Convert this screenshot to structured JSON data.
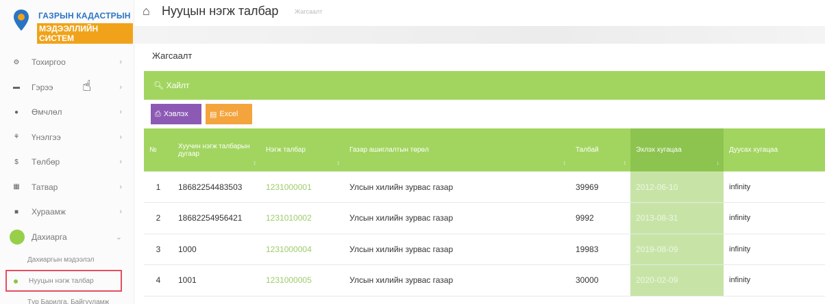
{
  "logo": {
    "line1": "ГАЗРЫН КАДАСТРЫН",
    "line2": "МЭДЭЭЛЛИЙН СИСТЕМ"
  },
  "sidebar": {
    "items": [
      {
        "label": "Тохиргоо",
        "icon": "settings-icon"
      },
      {
        "label": "Гэрээ",
        "icon": "document-icon"
      },
      {
        "label": "Өмчлөл",
        "icon": "circle-icon"
      },
      {
        "label": "Үнэлгээ",
        "icon": "people-icon"
      },
      {
        "label": "Төлбөр",
        "icon": "dollar-icon"
      },
      {
        "label": "Татвар",
        "icon": "table-icon"
      },
      {
        "label": "Хураамж",
        "icon": "box-icon"
      },
      {
        "label": "Дахиарга",
        "icon": "circle-icon"
      }
    ],
    "subitems": [
      {
        "label": "Дахиаргын мэдээлэл"
      },
      {
        "label": "Нууцын нэгж талбар",
        "active": true
      },
      {
        "label": "Түр Барилга, Байгууламж"
      }
    ]
  },
  "header": {
    "title": "Нууцын нэгж талбар",
    "subtitle": "Жагсаалт"
  },
  "main": {
    "section_title": "Жагсаалт",
    "search_label": "Хайлт",
    "print_label": "Хэвлэх",
    "excel_label": "Excel"
  },
  "table": {
    "headers": [
      "№",
      "Хуучин нэгж талбарын дугаар",
      "Нэгж талбар",
      "Газар ашиглалтын төрөл",
      "Талбай",
      "Эхлэх хугацаа",
      "Дуусах хугацаа"
    ],
    "rows": [
      {
        "no": "1",
        "old_id": "18682254483503",
        "parcel": "1231000001",
        "type": "Улсын хилийн зурвас газар",
        "area": "39969",
        "start": "2012-06-10",
        "end": "infinity"
      },
      {
        "no": "2",
        "old_id": "18682254956421",
        "parcel": "1231010002",
        "type": "Улсын хилийн зурвас газар",
        "area": "9992",
        "start": "2013-08-31",
        "end": "infinity"
      },
      {
        "no": "3",
        "old_id": "1000",
        "parcel": "1231000004",
        "type": "Улсын хилийн зурвас газар",
        "area": "19983",
        "start": "2019-08-09",
        "end": "infinity"
      },
      {
        "no": "4",
        "old_id": "1001",
        "parcel": "1231000005",
        "type": "Улсын хилийн зурвас газар",
        "area": "30000",
        "start": "2020-02-09",
        "end": "infinity"
      }
    ]
  },
  "colors": {
    "accent_green": "#a2d560",
    "print_purple": "#8c5ab4",
    "excel_orange": "#f4a43d",
    "logo_blue": "#2a74c5",
    "active_border": "#e44d5e"
  }
}
